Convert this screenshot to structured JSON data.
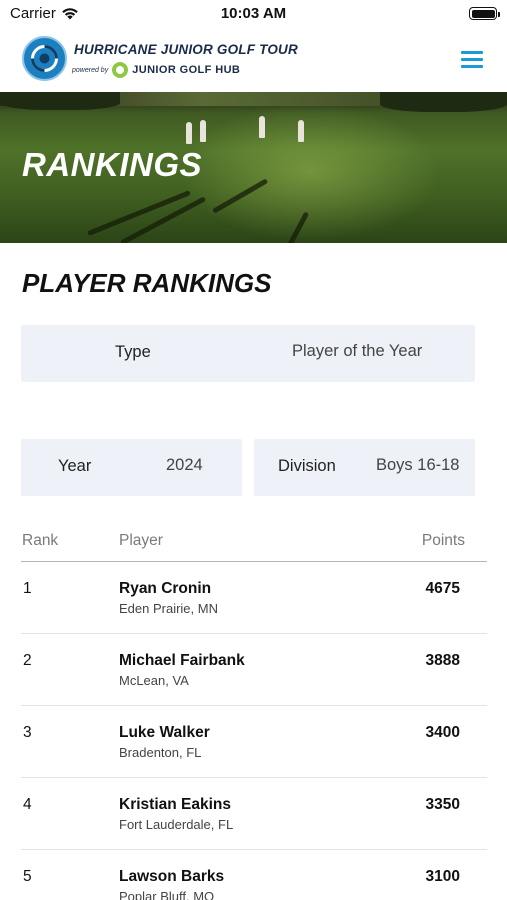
{
  "status_bar": {
    "carrier": "Carrier",
    "time": "10:03 AM"
  },
  "header": {
    "title": "HURRICANE JUNIOR GOLF TOUR",
    "powered_by": "powered by",
    "hub_name": "JUNIOR GOLF HUB",
    "accent_color": "#1c9ad6"
  },
  "hero": {
    "title": "RANKINGS"
  },
  "page": {
    "title": "PLAYER RANKINGS"
  },
  "filters": {
    "type": {
      "label": "Type",
      "value": "Player of the Year"
    },
    "year": {
      "label": "Year",
      "value": "2024"
    },
    "division": {
      "label": "Division",
      "value": "Boys 16-18"
    }
  },
  "table": {
    "columns": {
      "rank": "Rank",
      "player": "Player",
      "points": "Points"
    },
    "rows": [
      {
        "rank": "1",
        "name": "Ryan Cronin",
        "location": "Eden Prairie, MN",
        "points": "4675"
      },
      {
        "rank": "2",
        "name": "Michael Fairbank",
        "location": "McLean, VA",
        "points": "3888"
      },
      {
        "rank": "3",
        "name": "Luke Walker",
        "location": "Bradenton, FL",
        "points": "3400"
      },
      {
        "rank": "4",
        "name": "Kristian Eakins",
        "location": "Fort Lauderdale, FL",
        "points": "3350"
      },
      {
        "rank": "5",
        "name": "Lawson Barks",
        "location": "Poplar Bluff, MO",
        "points": "3100"
      }
    ]
  }
}
